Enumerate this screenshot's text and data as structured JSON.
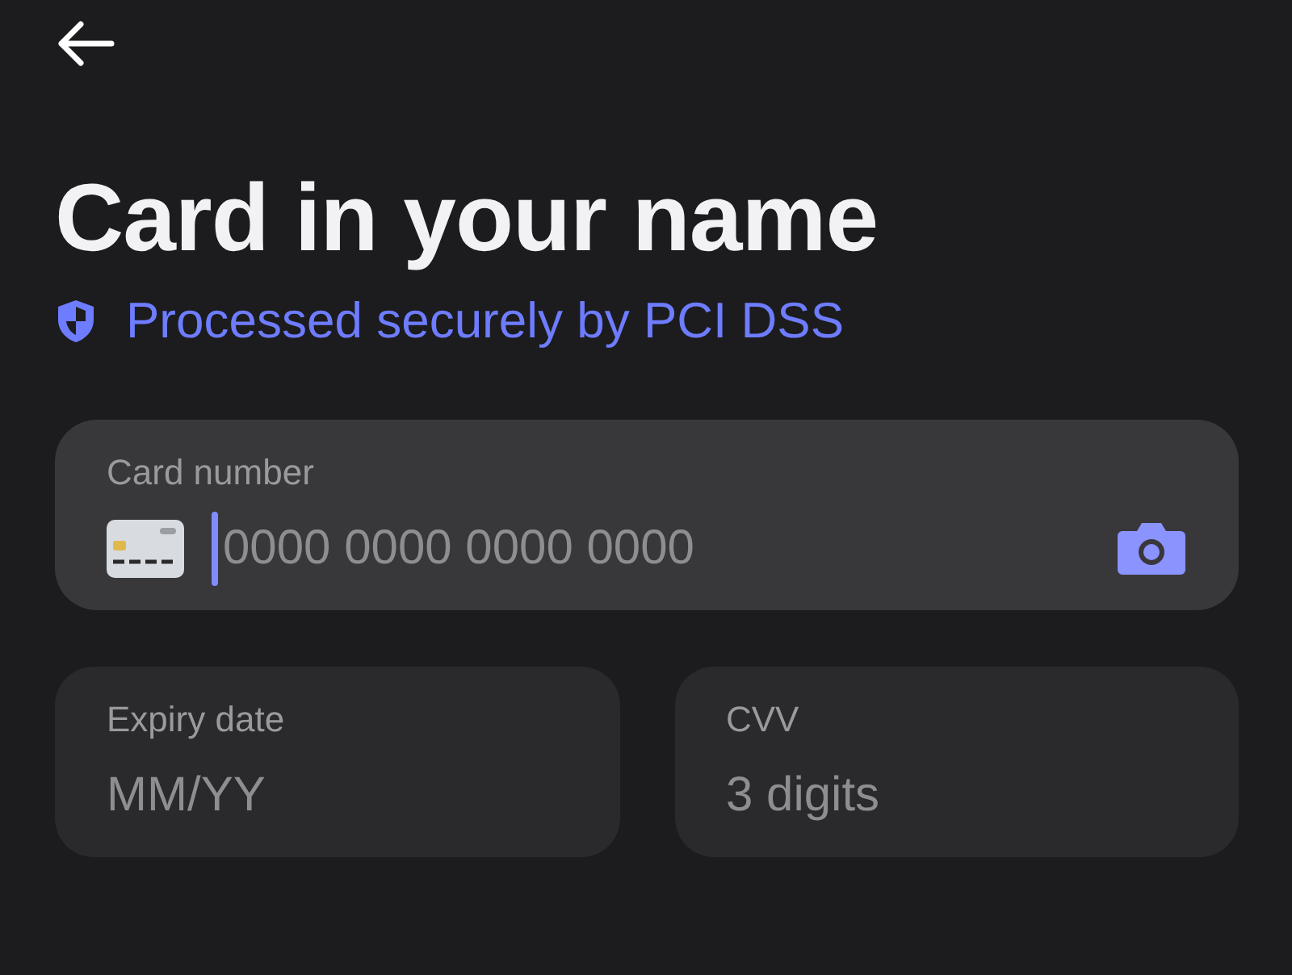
{
  "header": {
    "title": "Card in your name",
    "security_note": "Processed securely by PCI DSS"
  },
  "fields": [
    {
      "kind": "card",
      "label": "Card number",
      "placeholder": "0000 0000 0000 0000",
      "focused": true
    },
    {
      "kind": "plain",
      "label": "Expiry date",
      "placeholder": "MM/YY",
      "focused": false
    },
    {
      "kind": "plain",
      "label": "CVV",
      "placeholder": "3 digits",
      "focused": false
    }
  ]
}
